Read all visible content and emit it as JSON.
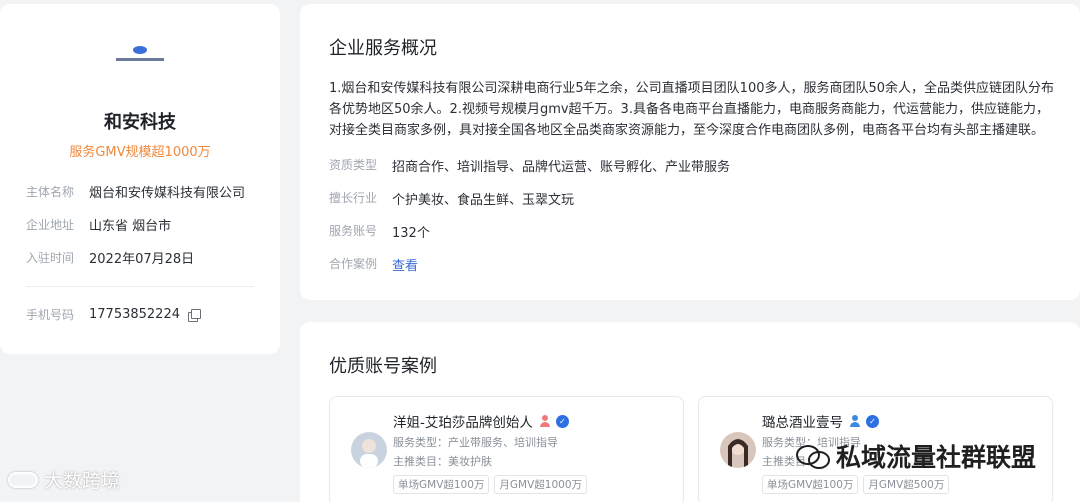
{
  "profile": {
    "company_name": "和安科技",
    "gmv_tag": "服务GMV规模超1000万",
    "rows": [
      {
        "label": "主体名称",
        "value": "烟台和安传媒科技有限公司"
      },
      {
        "label": "企业地址",
        "value": "山东省 烟台市"
      },
      {
        "label": "入驻时间",
        "value": "2022年07月28日"
      }
    ],
    "phone": {
      "label": "手机号码",
      "value": "17753852224"
    }
  },
  "overview": {
    "title": "企业服务概况",
    "description": "1.烟台和安传媒科技有限公司深耕电商行业5年之余，公司直播项目团队100多人，服务商团队50余人，全品类供应链团队分布各优势地区50余人。2.视频号规模月gmv超千万。3.具备各电商平台直播能力，电商服务商能力，代运营能力，供应链能力，对接全类目商家多例，具对接全国各地区全品类商家资源能力，至今深度合作电商团队多例，电商各平台均有头部主播建联。",
    "fields": [
      {
        "label": "资质类型",
        "value": "招商合作、培训指导、品牌代运营、账号孵化、产业带服务"
      },
      {
        "label": "擅长行业",
        "value": "个护美妆、食品生鲜、玉翠文玩"
      },
      {
        "label": "服务账号",
        "value": "132个"
      },
      {
        "label": "合作案例",
        "value": "查看"
      }
    ]
  },
  "cases": {
    "title": "优质账号案例",
    "items": [
      {
        "name": "洋姐-艾珀莎品牌创始人",
        "service_type": "服务类型：产业带服务、培训指导",
        "category": "主推类目：美妆护肤",
        "tags": [
          "单场GMV超100万",
          "月GMV超1000万"
        ],
        "badge_color": "#f07a7a"
      },
      {
        "name": "璐总酒业壹号",
        "service_type": "服务类型：培训指导",
        "category": "主推类目：",
        "tags": [
          "单场GMV超100万",
          "月GMV超500万"
        ],
        "badge_color": "#3a8be0"
      }
    ]
  },
  "watermarks": {
    "left": "大数跨境",
    "right": "私域流量社群联盟"
  }
}
